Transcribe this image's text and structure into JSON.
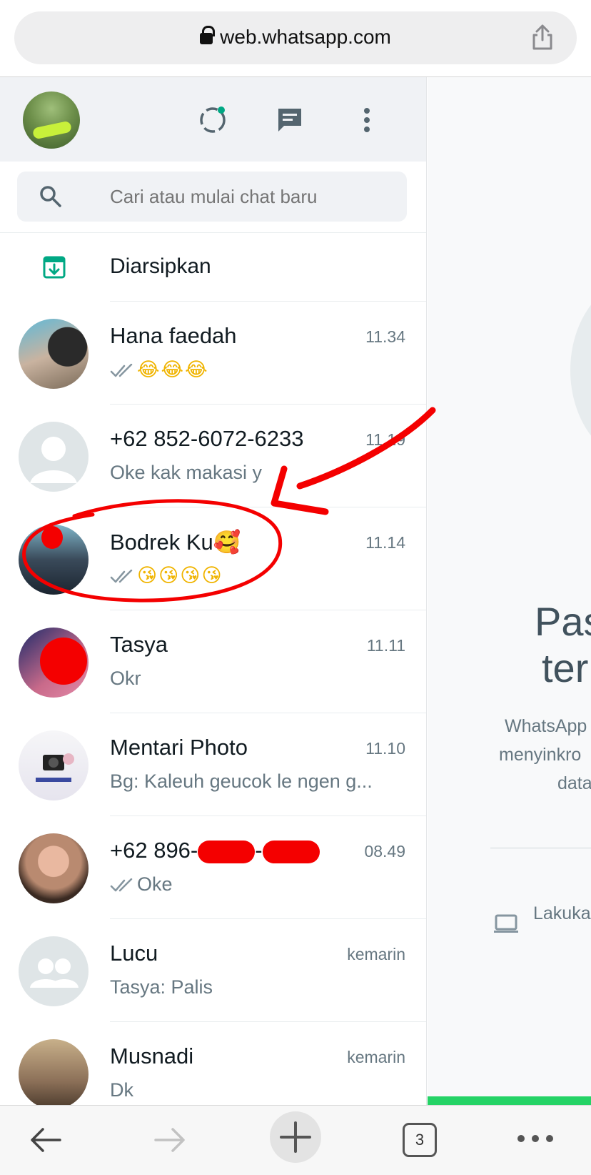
{
  "browser": {
    "url": "web.whatsapp.com",
    "tabs_count": "3"
  },
  "search": {
    "placeholder": "Cari atau mulai chat baru"
  },
  "archived": {
    "label": "Diarsipkan"
  },
  "chats": [
    {
      "name": "Hana faedah",
      "time": "11.34",
      "message": "😂😂😂",
      "ticks": true
    },
    {
      "name": "+62 852-6072-6233",
      "time": "11.19",
      "message": "Oke kak makasi y",
      "ticks": false
    },
    {
      "name": "Bodrek Ku🥰",
      "time": "11.14",
      "message": "😘😘😘😘",
      "ticks": true
    },
    {
      "name": "Tasya",
      "time": "11.11",
      "message": "Okr",
      "ticks": false
    },
    {
      "name": "Mentari Photo",
      "time": "11.10",
      "message": "Bg: Kaleuh geucok le ngen g...",
      "ticks": false
    },
    {
      "name": "+62 896-",
      "time": "08.49",
      "message": "Oke",
      "ticks": true
    },
    {
      "name": "Lucu",
      "time": "kemarin",
      "message": "Tasya: Palis",
      "ticks": false
    },
    {
      "name": "Musnadi",
      "time": "kemarin",
      "message": "Dk",
      "ticks": false
    }
  ],
  "right_panel": {
    "title_line1": "Pas",
    "title_line2": "ter",
    "body_line1": "WhatsApp",
    "body_line2": "menyinkro",
    "body_line3": "data",
    "link_text": "Lakuka"
  },
  "colors": {
    "accent": "#00a884",
    "annotation": "#f40000",
    "progress": "#25d366"
  }
}
